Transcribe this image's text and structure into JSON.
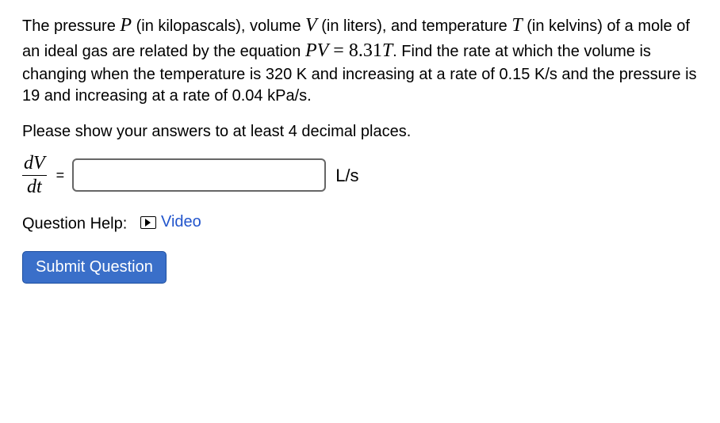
{
  "problem": {
    "text_part1": "The pressure ",
    "var_P": "P",
    "text_part2": " (in kilopascals), volume ",
    "var_V": "V",
    "text_part3": " (in liters), and temperature ",
    "var_T": "T",
    "text_part4": " (in kelvins) of a mole of an ideal gas are related by the equation ",
    "eq_PV": "PV",
    "eq_eq": " = ",
    "eq_rhs1": "8.31",
    "eq_rhs2": "T",
    "text_part5": ". Find the rate at which the volume is changing when the temperature is 320 K and increasing at a rate of 0.15 K/s and the pressure is 19 and increasing at a rate of 0.04 kPa/s."
  },
  "instructions": "Please show your answers to at least 4 decimal places.",
  "answer": {
    "frac_num": "dV",
    "frac_den": "dt",
    "equals": "=",
    "value": "",
    "unit": "L/s"
  },
  "help": {
    "label": "Question Help:",
    "video": "Video"
  },
  "submit": "Submit Question"
}
